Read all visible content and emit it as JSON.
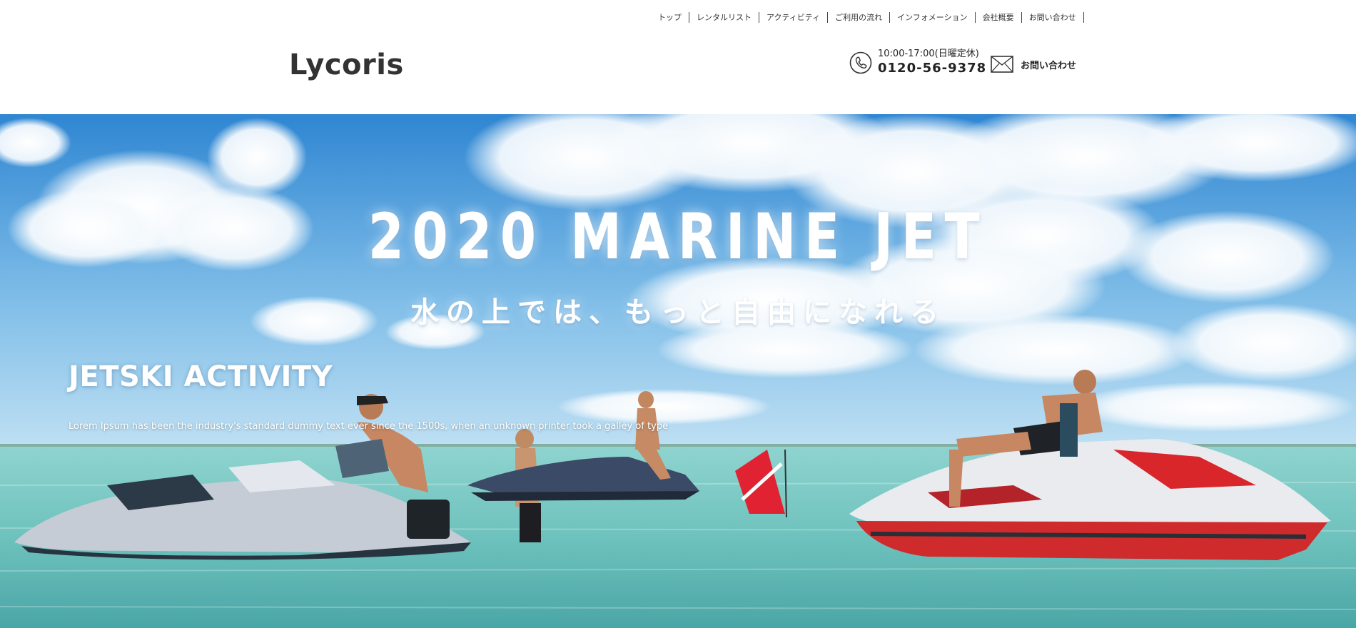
{
  "nav": {
    "items": [
      {
        "label": "トップ"
      },
      {
        "label": "レンタルリスト"
      },
      {
        "label": "アクティビティ"
      },
      {
        "label": "ご利用の流れ"
      },
      {
        "label": "インフォメーション"
      },
      {
        "label": "会社概要"
      },
      {
        "label": "お問い合わせ"
      }
    ]
  },
  "header": {
    "logo": "Lycoris",
    "hours": "10:00-17:00(日曜定休)",
    "phone": "0120-56-9378",
    "contact_label": "お問い合わせ"
  },
  "hero": {
    "title": "2020 MARINE JET",
    "subtitle": "水の上では、もっと自由になれる",
    "section_title": "JETSKI ACTIVITY",
    "section_desc": "Lorem Ipsum has been the industry's standard dummy text ever since the 1500s, when an unknown printer took a galley of type"
  },
  "colors": {
    "sky_top": "#3a8fd6",
    "sky_low": "#a9d4f0",
    "sea": "#7fc8c4",
    "jet_red": "#d8262b"
  },
  "icons": {
    "phone": "phone-icon",
    "mail": "mail-icon"
  }
}
